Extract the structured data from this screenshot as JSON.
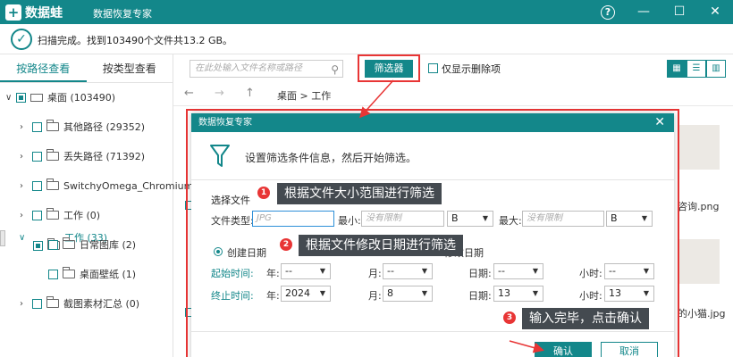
{
  "titlebar": {
    "logo_text": "数据蛙",
    "logo_cross": "+",
    "app_title": "数据恢复专家",
    "help": "?",
    "minimize": "—",
    "maximize": "☐",
    "close": "✕"
  },
  "status": {
    "text": "扫描完成。找到103490个文件共13.2 GB。"
  },
  "left_tabs": [
    "按路径查看",
    "按类型查看"
  ],
  "tree": [
    {
      "label": "桌面 (103490)"
    },
    {
      "label": "其他路径 (29352)"
    },
    {
      "label": "丢失路径 (71392)"
    },
    {
      "label": "SwitchyOmega_Chromium"
    },
    {
      "label": "工作 (0)"
    },
    {
      "label": "工作 (33)"
    },
    {
      "label": "日常图库 (2)"
    },
    {
      "label": "桌面壁纸 (1)"
    },
    {
      "label": "截图素材汇总 (0)"
    }
  ],
  "toolbar": {
    "search_placeholder": "在此处输入文件名称或路径",
    "search_icon": "⚲",
    "filter_label": "筛选器",
    "only_deleted_label": "仅显示删除项",
    "view_icons": [
      "▦",
      "☰",
      "▥"
    ]
  },
  "nav": {
    "back": "←",
    "forward": "→",
    "up": "↑",
    "path": "桌面 > 工作"
  },
  "side_captions": [
    "咨询.png",
    "的小猫.jpg"
  ],
  "dialog": {
    "title": "数据恢复专家",
    "close": "✕",
    "intro": "设置筛选条件信息，然后开始筛选。",
    "section_file": "选择文件",
    "file_type_label": "文件类型:",
    "file_type_placeholder": "JPG",
    "min_label": "最小:",
    "min_placeholder": "没有限制",
    "min_unit": "B",
    "max_label": "最大:",
    "max_placeholder": "没有限制",
    "max_unit": "B",
    "create_date_label": "创建日期",
    "modify_date_label": "修改日期",
    "start_label": "起始时间:",
    "end_label": "终止时间:",
    "year_label": "年:",
    "month_label": "月:",
    "day_label": "日期:",
    "hour_label": "小时:",
    "start_year": "--",
    "start_month": "--",
    "start_day": "--",
    "start_hour": "--",
    "end_year": "2024",
    "end_month": "8",
    "end_day": "13",
    "end_hour": "13",
    "ok_label": "确认",
    "cancel_label": "取消"
  },
  "callouts": [
    {
      "num": "1",
      "text": "根据文件大小范围进行筛选"
    },
    {
      "num": "2",
      "text": "根据文件修改日期进行筛选"
    },
    {
      "num": "3",
      "text": "输入完毕，点击确认"
    }
  ],
  "colors": {
    "accent": "#13878a",
    "annotation_red": "#e83535",
    "callout_bg": "#444a50"
  }
}
